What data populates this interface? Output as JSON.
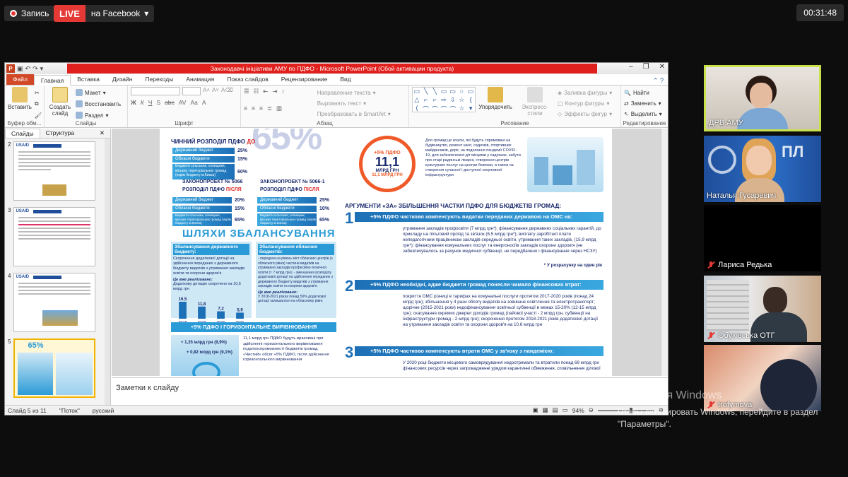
{
  "stream": {
    "record_label": "Запись",
    "live_label": "LIVE",
    "destination": "на Facebook",
    "timer": "00:31:48"
  },
  "ppt": {
    "window_title": "Законодавчі ініціативи АМУ по ПДФО  -  Microsoft PowerPoint (Сбой активации продукта)",
    "tabs": [
      "Файл",
      "Главная",
      "Вставка",
      "Дизайн",
      "Переходы",
      "Анимация",
      "Показ слайдов",
      "Рецензирование",
      "Вид"
    ],
    "ribbon": {
      "paste": "Вставить",
      "create_slide": "Создать слайд",
      "layout": "Макет",
      "restore": "Восстановить",
      "section": "Раздел",
      "clipboard_group": "Буфер обм...",
      "slides_group": "Слайды",
      "font_group": "Шрифт",
      "paragraph_group": "Абзац",
      "text_direction": "Направление текста",
      "align_text": "Выровнять текст",
      "convert_smartart": "Преобразовать в SmartArt",
      "arrange": "Упорядочить",
      "quick_styles": "Экспресс-стили",
      "fill": "Заливка фигуры",
      "outline": "Контур фигуры",
      "effects": "Эффекты фигур",
      "drawing_group": "Рисование",
      "find": "Найти",
      "replace": "Заменить",
      "select": "Выделить",
      "editing_group": "Редактирование"
    },
    "panel_tabs": [
      "Слайды",
      "Структура"
    ],
    "thumb_numbers": [
      "2",
      "3",
      "4",
      "5"
    ],
    "thumb_logo": "USAID",
    "notes_placeholder": "Заметки к слайду",
    "status": {
      "slide_of": "Слайд 5 из 11",
      "theme": "\"Поток\"",
      "lang": "русский",
      "zoom": "94%"
    }
  },
  "slide": {
    "pct": "65%",
    "current": "ЧИННИЙ РОЗПОДІЛ ПДФО",
    "current_red": "ДО",
    "bars_before": [
      {
        "label": "Державний бюджет",
        "value": "25%"
      },
      {
        "label": "Обласні бюджети",
        "value": "15%"
      },
      {
        "label": "Бюджети сільських, селищних, міських територіальних громад (окрім бюджету м.Києва)",
        "value": "60%"
      }
    ],
    "law1": "ЗАКОНОПРОЕКТ № 5066",
    "law2": "ЗАКОНОПРОЕКТ № 5066-1",
    "after_label": "РОЗПОДІЛ ПДФО",
    "after_red": "ПІСЛЯ",
    "bars_after1": [
      {
        "label": "Державний бюджет",
        "value": "20%"
      },
      {
        "label": "Обласні бюджети",
        "value": "15%"
      },
      {
        "label": "Бюджети сільських, селищних, міських територіальних громад (окрім бюджету м.Києва)",
        "value": "65%"
      }
    ],
    "bars_after2": [
      {
        "label": "Державний бюджет",
        "value": "25%"
      },
      {
        "label": "Обласні бюджети",
        "value": "10%"
      },
      {
        "label": "Бюджети сільських, селищних, міських територіальних громад (окрім бюджету м.Києва)",
        "value": "65%"
      }
    ],
    "ways_title": "ШЛЯХИ ЗБАЛАНСУВАННЯ",
    "state_title": "Збалансування державного бюджету:",
    "state_text": "Скорочення додаткової дотації на здійснення переданих з державного бюджету видатків з утримання закладів освіти та охорони здоров'я.",
    "state_done": "Це вже реалізовано:",
    "state_done_text": "Додаткову дотацію скорочено на 10,6 млрд грн",
    "chart_values": [
      "16,5",
      "11,8",
      "7,2",
      "5,9"
    ],
    "chart_years": [
      "2018",
      "2019",
      "2020",
      "2021"
    ],
    "oblast_title": "Збалансування обласних бюджетів:",
    "oblast_text": "- передача на рівень міст обласних центрів (з обласного рівня) частини видатків на утримання закладів професійно-технічної освіти (≈ 7 млрд грн); - зменшення розподілу додаткової дотації на здійснення переданих з державного бюджету видатків з утримання закладів освіти та охорони здоров'я.",
    "oblast_done": "Це вже реалізовано:",
    "oblast_done_text": "У 2018-2021 роках понад 50% додаткової дотації залишалося на обласному рівні.",
    "horizontal_title": "+5% ПДФО І ГОРИЗОНТАЛЬНЕ ВИРІВНЮВАННЯ",
    "h_val1": "+ 1,35 млрд грн (9,9%)",
    "h_val2": "+ 0,82 млрд грн (9,1%)",
    "h_text": "11,1 млрд грн ПДФО будуть враховані при здійсненні горизонтального вирівнювання податкоспроможності бюджетів громад. «Чистий» обсяг +5% ПДФО, після здійснення горизонтального вирівнювання",
    "seal_top": "+5% ПДФО",
    "seal_num": "11,1",
    "seal_unit": "МЛРД ГРН",
    "seal_bottom": "11,1 МЛРД ГРН",
    "intro": "Для громад це кошти, які будуть спрямовані на будівництво, ремонт шкіл, садочків, спортивних майданчиків, доріг, на подолання пандемії COVID - 19, для забезпечення діт місцями у садочках, забути про старі радянські лікарні, створення центрів культурних послуг на центри безпеки, а також на створення сучасної і доступної спортивної інфраструктури",
    "args_title": "АРГУМЕНТИ «ЗА» ЗБІЛЬШЕННЯ ЧАСТКИ ПДФО ДЛЯ БЮДЖЕТІВ ГРОМАД:",
    "arg1_title": "+5% ПДФО частково компенсують видатки переданих державою на ОМС на:",
    "arg1_text": "утримання закладів профосвіти (7 млрд грн*); фінансування державних соціальних гарантій, до прикладу на пільговий проїзд та зв'язок (6,5 млрд грн*); виплату заробітної плати непедагогічним працівникам закладів середньої освіти, утримання таких закладів, (15,9 млрд грн*); фінансування комунальних послуг та енергоносіїв закладів охорони здоров'я (не забезпечувалось за рахунок медичної субвенції, не передбачено і фінансування через НСЗУ)",
    "arg1_note": "* У розрахунку на один рік",
    "arg2_title": "+5% ПДФО необхідні, адже бюджети громад понесли чимало фінансових втрат:",
    "arg2_text": "покриття ОМС різниці в тарифах на комунальні послуги протягом 2017-2020 років (понад 24 млрд грн); збільшення у 4 рази обсягу видатків на зовнішнє освітлення та електротранспорт; щорічне (2015-2021 роки) недофінансування освітньої субвенції в межах 15-20% (12-15 млрд грн); скасування окремих джерел доходів громад (пайової участі - 2 млрд грн, субвенції на інфраструктури громад - 2 млрд грн); скорочення протягом 2018-2021 років додаткової дотації на утримання закладів освіти та охорони здоров'я на 10,6 млрд грн",
    "arg3_title": "+5% ПДФО частково компенсують втрати ОМС у зв'язку з пандемією:",
    "arg3_text": "У 2020 році бюджети місцевого самоврядування недоотримали та втратили понад 69 млрд грн фінансових ресурсів через запровадженні урядом карантинні обмеження, сповільнення ділової"
  },
  "participants": [
    {
      "name": "ДРВ АМУ",
      "muted": false
    },
    {
      "name": "Наталья Гусаревич",
      "muted": false
    },
    {
      "name": "Лариса Редька",
      "muted": true
    },
    {
      "name": "Обухівська ОТГ",
      "muted": true
    },
    {
      "name": "trofymova",
      "muted": true
    }
  ],
  "activation": {
    "line1": "Активация Windows",
    "line2": "Чтобы активировать Windows, перейдите в раздел \"Параметры\"."
  },
  "colors": {
    "live_red": "#e53935",
    "ppt_title_red": "#e0201c",
    "slide_blue": "#2b9bd7",
    "active_tile_border": "#c9e14b"
  }
}
